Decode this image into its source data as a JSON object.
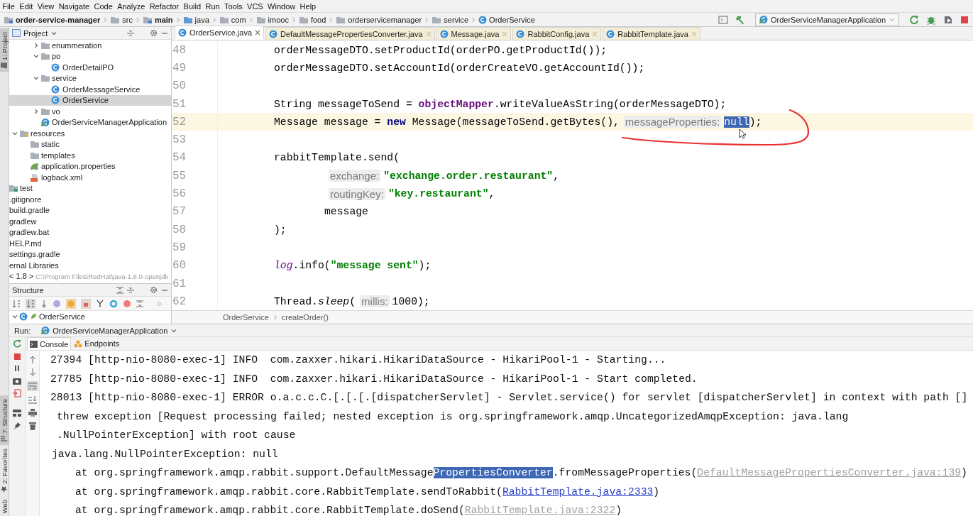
{
  "menu": [
    "File",
    "Edit",
    "View",
    "Navigate",
    "Code",
    "Analyze",
    "Refactor",
    "Build",
    "Run",
    "Tools",
    "VCS",
    "Window",
    "Help"
  ],
  "navigation_bar": {
    "path": [
      {
        "label": "order-service-manager",
        "kind": "module"
      },
      {
        "label": "src",
        "kind": "folder"
      },
      {
        "label": "main",
        "kind": "module"
      },
      {
        "label": "java",
        "kind": "source-root"
      },
      {
        "label": "com",
        "kind": "folder"
      },
      {
        "label": "imooc",
        "kind": "folder"
      },
      {
        "label": "food",
        "kind": "folder"
      },
      {
        "label": "orderservicemanager",
        "kind": "folder"
      },
      {
        "label": "service",
        "kind": "folder"
      },
      {
        "label": "OrderService",
        "kind": "class"
      }
    ],
    "run_configuration": "OrderServiceManagerApplication"
  },
  "tool_window_strip": {
    "top": [
      {
        "label": "1: Project",
        "kind": "project",
        "selected": true
      }
    ],
    "bottom": [
      {
        "label": "7: Structure",
        "kind": "structure",
        "selected": true
      },
      {
        "label": "2: Favorites",
        "kind": "favorites",
        "selected": false
      },
      {
        "label": "Web",
        "kind": "web",
        "selected": false
      }
    ]
  },
  "project": {
    "title": "Project",
    "tree": [
      {
        "children": [
          {
            "children": [
              {
                "children": [
                  {
                    "children": [
                      {
                        "label": "enummeration",
                        "kind": "package",
                        "expanded": false,
                        "selected": false
                      },
                      {
                        "label": "po",
                        "kind": "package",
                        "expanded": true,
                        "selected": false,
                        "children": [
                          {
                            "label": "OrderDetailPO",
                            "kind": "class",
                            "selected": false
                          }
                        ]
                      },
                      {
                        "label": "service",
                        "kind": "package",
                        "expanded": true,
                        "selected": false,
                        "children": [
                          {
                            "label": "OrderMessageService",
                            "kind": "class",
                            "selected": false
                          },
                          {
                            "label": "OrderService",
                            "kind": "class",
                            "selected": true
                          }
                        ]
                      },
                      {
                        "label": "vo",
                        "kind": "package",
                        "expanded": false,
                        "selected": false
                      },
                      {
                        "label": "OrderServiceManagerApplication",
                        "kind": "application",
                        "selected": false
                      }
                    ]
                  }
                ]
              },
              {
                "label": "resources",
                "kind": "resources",
                "expanded": true,
                "selected": false,
                "children": [
                  {
                    "label": "static",
                    "kind": "folder",
                    "selected": false
                  },
                  {
                    "label": "templates",
                    "kind": "folder",
                    "selected": false
                  },
                  {
                    "label": "application.properties",
                    "kind": "properties",
                    "selected": false
                  },
                  {
                    "label": "logback.xml",
                    "kind": "xml",
                    "selected": false
                  }
                ]
              }
            ]
          },
          {
            "label": "test",
            "kind": "test-folder",
            "selected": false
          }
        ]
      },
      {
        "label": ".gitignore",
        "selected": false
      },
      {
        "label": "build.gradle",
        "selected": false
      },
      {
        "label": "gradlew",
        "selected": false
      },
      {
        "label": "gradlew.bat",
        "selected": false
      },
      {
        "label": "HELP.md",
        "selected": false
      },
      {
        "label": "settings.gradle",
        "selected": false
      },
      {
        "label": "ernal Libraries",
        "selected": false
      },
      {
        "label": "< 1.8 >",
        "path": "C:\\Program Files\\RedHat\\java-1.8.0-openjdk",
        "selected": false
      }
    ]
  },
  "structure": {
    "title": "Structure",
    "tree": [
      {
        "label": "OrderService",
        "kind": "class",
        "expanded": true,
        "selected": false
      }
    ]
  },
  "editor": {
    "tabs": [
      {
        "label": "OrderService.java",
        "kind": "project",
        "selected": true
      },
      {
        "label": "DefaultMessagePropertiesConverter.java",
        "kind": "library",
        "selected": false
      },
      {
        "label": "Message.java",
        "kind": "library",
        "selected": false
      },
      {
        "label": "RabbitConfig.java",
        "kind": "library",
        "selected": false
      },
      {
        "label": "RabbitTemplate.java",
        "kind": "library",
        "selected": false
      }
    ],
    "lines": [
      {
        "number": "48",
        "current": false,
        "tokens": [
          {
            "text": "orderMessageDTO.setProductId(orderPO.getProductId());",
            "kind": "plain"
          }
        ]
      },
      {
        "number": "49",
        "current": false,
        "tokens": [
          {
            "text": "orderMessageDTO.setAccountId(orderCreateVO.getAccountId());",
            "kind": "plain"
          }
        ]
      },
      {
        "number": "50",
        "current": false
      },
      {
        "number": "51",
        "current": false,
        "tokens": [
          {
            "text": "String messageToSend = ",
            "kind": "plain"
          },
          {
            "text": "objectMapper",
            "kind": "field"
          },
          {
            "text": ".writeValueAsString(orderMessageDTO);",
            "kind": "plain"
          }
        ]
      },
      {
        "number": "52",
        "current": true,
        "tokens": [
          {
            "text": "Message message = ",
            "kind": "plain"
          },
          {
            "text": "new",
            "kind": "keyword"
          },
          {
            "text": " Message(messageToSend.getBytes(),",
            "kind": "plain"
          },
          {
            "text": "messageProperties:",
            "kind": "hint"
          },
          {
            "text": "null",
            "kind": "selected"
          },
          {
            "text": ");",
            "kind": "plain"
          }
        ]
      },
      {
        "number": "53",
        "current": false
      },
      {
        "number": "54",
        "current": false,
        "tokens": [
          {
            "text": "rabbitTemplate.send(",
            "kind": "plain"
          }
        ],
        "children": [
          {
            "number": "55",
            "current": false,
            "tokens": [
              {
                "text": "exchange:",
                "kind": "hint"
              },
              {
                "text": "\"exchange.order.restaurant\"",
                "kind": "string"
              },
              {
                "text": ",",
                "kind": "plain"
              }
            ]
          },
          {
            "number": "56",
            "current": false,
            "tokens": [
              {
                "text": "routingKey:",
                "kind": "hint"
              },
              {
                "text": "\"key.restaurant\"",
                "kind": "string"
              },
              {
                "text": ",",
                "kind": "plain"
              }
            ]
          },
          {
            "number": "57",
            "current": false,
            "tokens": [
              {
                "text": "message",
                "kind": "plain"
              }
            ]
          }
        ]
      },
      {
        "number": "58",
        "current": false,
        "tokens": [
          {
            "text": ");",
            "kind": "plain"
          }
        ]
      },
      {
        "number": "59",
        "current": false
      },
      {
        "number": "60",
        "current": false,
        "tokens": [
          {
            "text": "log",
            "kind": "static-field"
          },
          {
            "text": ".info(",
            "kind": "plain"
          },
          {
            "text": "\"message sent\"",
            "kind": "string"
          },
          {
            "text": ");",
            "kind": "plain"
          }
        ]
      },
      {
        "number": "61",
        "current": false
      },
      {
        "number": "62",
        "current": false,
        "tokens": [
          {
            "text": "Thread.",
            "kind": "plain"
          },
          {
            "text": "sleep",
            "kind": "static-method"
          },
          {
            "text": "(",
            "kind": "plain"
          },
          {
            "text": "millis:",
            "kind": "hint"
          },
          {
            "text": "1000",
            "kind": "plain"
          },
          {
            "text": ");",
            "kind": "plain"
          }
        ]
      }
    ],
    "breadcrumb": [
      "OrderService",
      "createOrder()"
    ]
  },
  "run": {
    "label": "Run:",
    "configuration": "OrderServiceManagerApplication",
    "tabs": [
      {
        "label": "Console",
        "kind": "console",
        "selected": true
      },
      {
        "label": "Endpoints",
        "kind": "endpoints",
        "selected": false
      }
    ],
    "console": [
      {
        "kind": "entry",
        "segments": [
          {
            "text": "27394 [http-nio-8080-exec-1] INFO  com.zaxxer.hikari.HikariDataSource - HikariPool-1 - Starting...",
            "kind": "plain"
          }
        ]
      },
      {
        "kind": "entry",
        "segments": [
          {
            "text": "27785 [http-nio-8080-exec-1] INFO  com.zaxxer.hikari.HikariDataSource - HikariPool-1 - Start completed.",
            "kind": "plain"
          }
        ]
      },
      {
        "kind": "entry",
        "segments": [
          {
            "text": "28013 [http-nio-8080-exec-1] ERROR o.a.c.c.C.[.[.[.[dispatcherServlet] - Servlet.service() for servlet [dispatcherServlet] in context with path []",
            "kind": "plain"
          }
        ]
      },
      {
        "kind": "continuation",
        "segments": [
          {
            "text": "threw exception [Request processing failed; nested exception is org.springframework.amqp.UncategorizedAmqpException: java.lang",
            "kind": "plain"
          }
        ]
      },
      {
        "kind": "continuation",
        "segments": [
          {
            "text": ".NullPointerException] with root cause",
            "kind": "plain"
          }
        ]
      },
      {
        "kind": "exception",
        "segments": [
          {
            "text": "java.lang.NullPointerException: null",
            "kind": "plain"
          }
        ]
      },
      {
        "kind": "frame",
        "segments": [
          {
            "text": "at org.springframework.amqp.rabbit.support.DefaultMessage",
            "kind": "plain"
          },
          {
            "text": "PropertiesConverter",
            "kind": "selected"
          },
          {
            "text": ".fromMessageProperties(",
            "kind": "plain"
          },
          {
            "text": "DefaultMessagePropertiesConverter.java:139",
            "kind": "dim-link"
          },
          {
            "text": ")",
            "kind": "plain"
          }
        ]
      },
      {
        "kind": "frame",
        "segments": [
          {
            "text": "at org.springframework.amqp.rabbit.core.RabbitTemplate.sendToRabbit(",
            "kind": "plain"
          },
          {
            "text": "RabbitTemplate.java:2333",
            "kind": "link"
          },
          {
            "text": ")",
            "kind": "plain"
          }
        ]
      },
      {
        "kind": "frame",
        "segments": [
          {
            "text": "at org.springframework.amqp.rabbit.core.RabbitTemplate.doSend(",
            "kind": "plain"
          },
          {
            "text": "RabbitTemplate.java:2322",
            "kind": "dim-link"
          },
          {
            "text": ")",
            "kind": "plain"
          }
        ]
      }
    ]
  }
}
